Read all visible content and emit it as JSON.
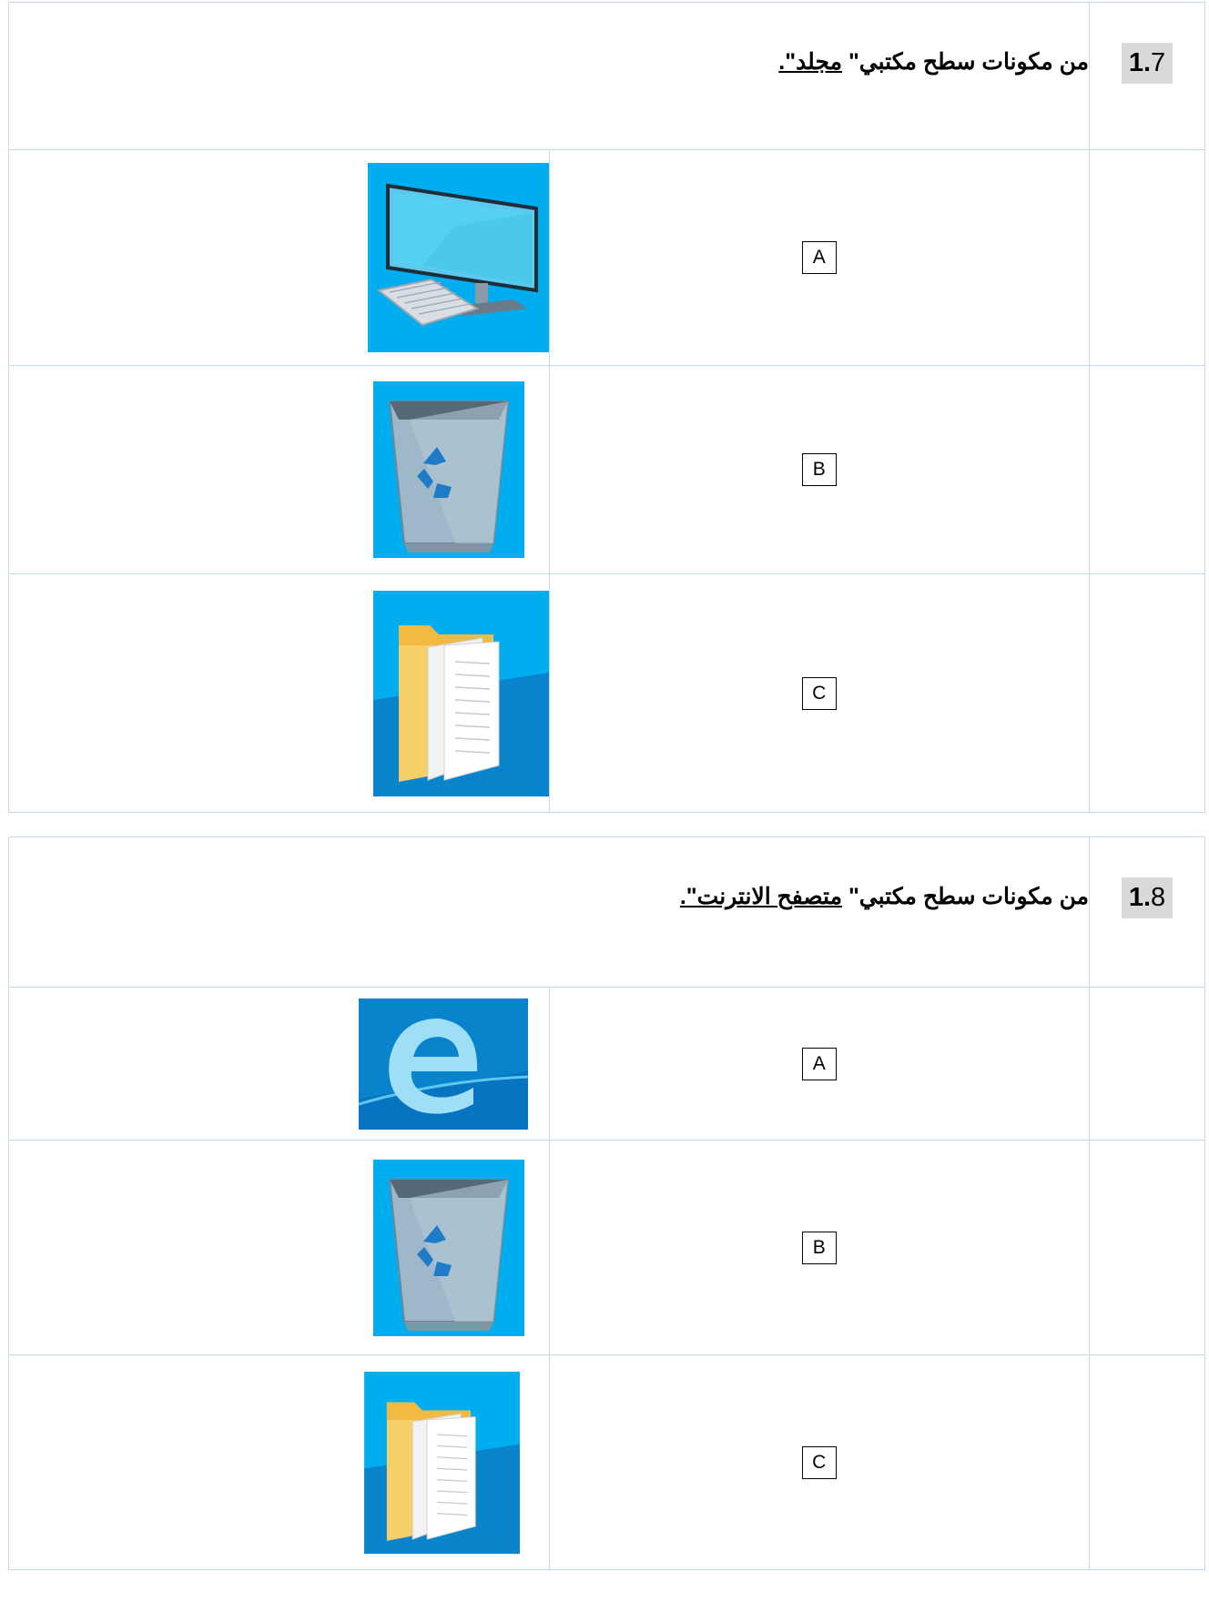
{
  "questions": [
    {
      "number_bold": "1.",
      "number_rest": "7",
      "text_prefix": "من مكونات سطح مكتبي\" ",
      "text_underlined": "مجلد\".",
      "options": [
        {
          "label": "A",
          "icon": "computer-icon"
        },
        {
          "label": "B",
          "icon": "recycle-bin-icon"
        },
        {
          "label": "C",
          "icon": "folder-icon"
        }
      ]
    },
    {
      "number_bold": "1.",
      "number_rest": "8",
      "text_prefix": "من مكونات سطح مكتبي\" ",
      "text_underlined": "متصفح الانترنت\".",
      "options": [
        {
          "label": "A",
          "icon": "edge-browser-icon"
        },
        {
          "label": "B",
          "icon": "recycle-bin-icon"
        },
        {
          "label": "C",
          "icon": "folder-icon"
        }
      ]
    }
  ],
  "colors": {
    "border": "#c6d9f1",
    "number_bg": "#d9d9d9",
    "icon_blue": "#00aeef"
  }
}
